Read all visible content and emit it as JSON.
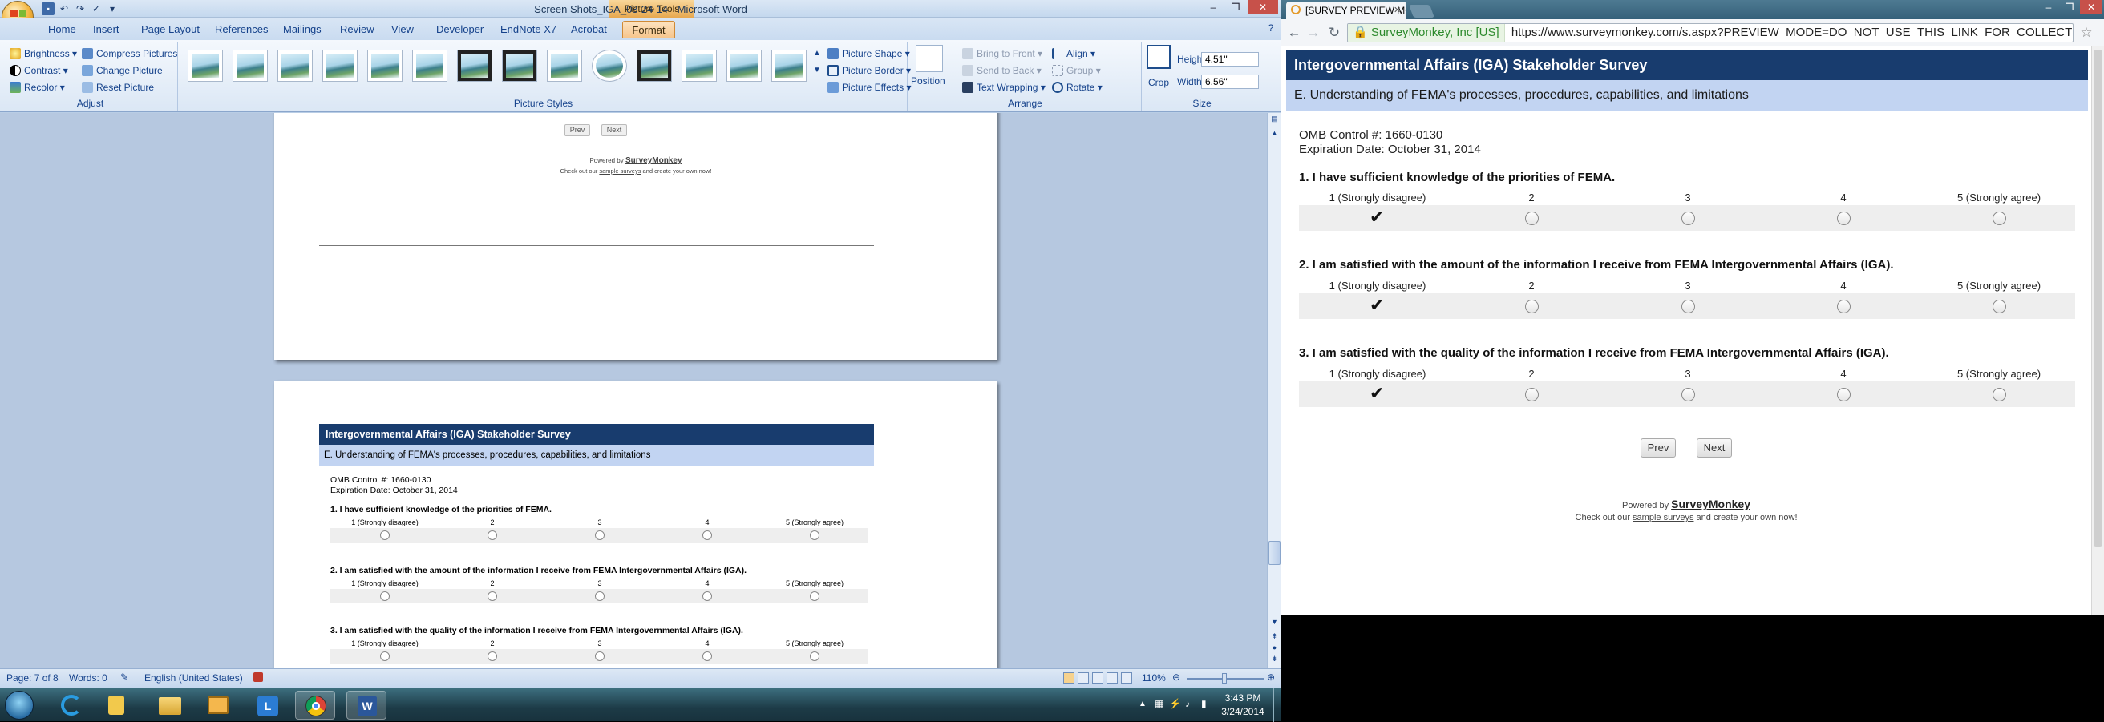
{
  "word": {
    "window_title": "Screen Shots_IGA_03-24-14 - Microsoft Word",
    "context_tab_title": "Picture Tools",
    "tabs": [
      "Home",
      "Insert",
      "Page Layout",
      "References",
      "Mailings",
      "Review",
      "View",
      "Developer",
      "EndNote X7",
      "Acrobat",
      "Format"
    ],
    "active_tab": "Format",
    "ribbon": {
      "adjust": {
        "label": "Adjust",
        "brightness": "Brightness",
        "contrast": "Contrast",
        "recolor": "Recolor",
        "compress": "Compress Pictures",
        "change": "Change Picture",
        "reset": "Reset Picture"
      },
      "styles": {
        "label": "Picture Styles",
        "shape": "Picture Shape",
        "border": "Picture Border",
        "effects": "Picture Effects"
      },
      "arrange": {
        "label": "Arrange",
        "position": "Position",
        "bring_front": "Bring to Front",
        "send_back": "Send to Back",
        "text_wrapping": "Text Wrapping",
        "align": "Align",
        "group": "Group",
        "rotate": "Rotate"
      },
      "size": {
        "label": "Size",
        "crop": "Crop",
        "height_label": "Height:",
        "height_value": "4.51\"",
        "width_label": "Width:",
        "width_value": "6.56\""
      }
    },
    "doc": {
      "prev": "Prev",
      "next": "Next",
      "powered_by": "Powered by",
      "brand": "SurveyMonkey",
      "check_out_prefix": "Check out our",
      "sample_surveys": "sample surveys",
      "check_out_suffix": "and create your own now!"
    },
    "status": {
      "page": "Page: 7 of 8",
      "words": "Words: 0",
      "language": "English (United States)",
      "zoom": "110%"
    }
  },
  "taskbar": {
    "time": "3:43 PM",
    "date": "3/24/2014"
  },
  "chrome": {
    "tab_title": "[SURVEY PREVIEW MODE]",
    "cert_owner": "SurveyMonkey, Inc [US]",
    "url": "https://www.surveymonkey.com/s.aspx?PREVIEW_MODE=DO_NOT_USE_THIS_LINK_FOR_COLLECTION"
  },
  "survey": {
    "title": "Intergovernmental Affairs (IGA) Stakeholder Survey",
    "section": "E. Understanding of FEMA's processes, procedures, capabilities, and limitations",
    "omb": "OMB Control #: 1660-0130",
    "expiration": "Expiration Date: October 31, 2014",
    "scale": [
      "1 (Strongly disagree)",
      "2",
      "3",
      "4",
      "5 (Strongly agree)"
    ],
    "questions": [
      {
        "text": "1. I have sufficient knowledge of the priorities of FEMA.",
        "selected": 1
      },
      {
        "text": "2. I am satisfied with the amount of the information I receive from FEMA Intergovernmental Affairs (IGA).",
        "selected": 1
      },
      {
        "text": "3. I am satisfied with the quality of the information I receive from FEMA Intergovernmental Affairs (IGA).",
        "selected": 1
      }
    ],
    "prev": "Prev",
    "next": "Next",
    "powered_by": "Powered by",
    "brand": "SurveyMonkey",
    "check_out_prefix": "Check out our",
    "sample_surveys": "sample surveys",
    "check_out_suffix": "and create your own now!"
  }
}
